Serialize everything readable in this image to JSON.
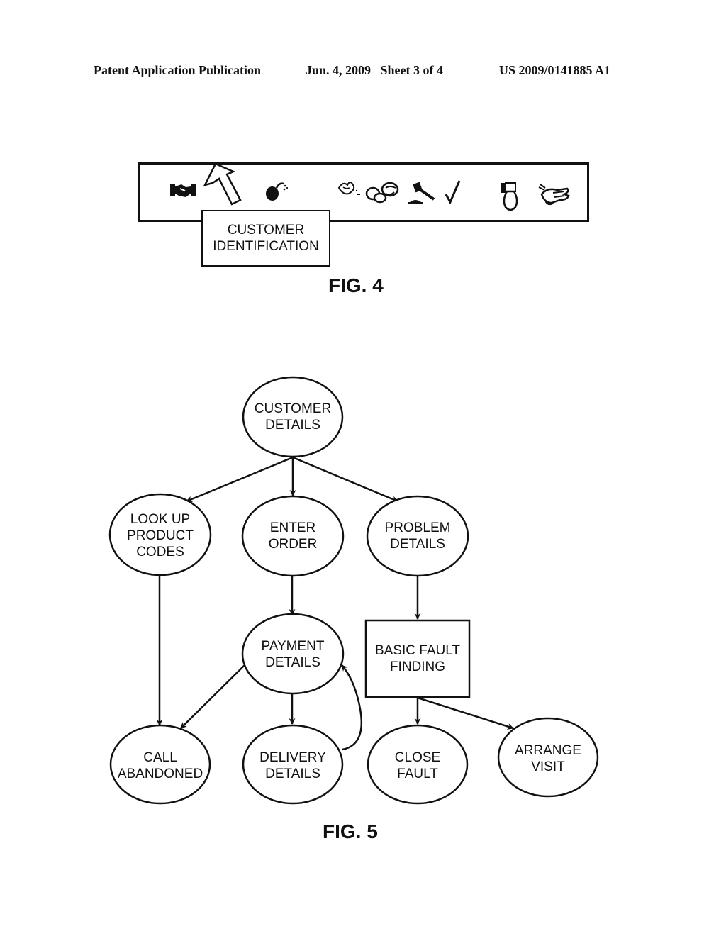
{
  "header": {
    "publication": "Patent Application Publication",
    "date_sheet": "Jun. 4, 2009   Sheet 3 of 4",
    "patent_number": "US 2009/0141885 A1"
  },
  "fig4": {
    "label": "FIG. 4",
    "toolbar_icons": [
      "handshake-icon",
      "cursor-arrow-icon",
      "bomb-icon",
      "bird-icon",
      "cloud-icon",
      "gavel-icon",
      "checkmark-icon",
      "lightbulb-icon",
      "helping-hand-icon"
    ],
    "tooltip": {
      "line1": "CUSTOMER",
      "line2": "IDENTIFICATION"
    }
  },
  "fig5": {
    "label": "FIG. 5",
    "nodes": {
      "customer_details": [
        "CUSTOMER",
        "DETAILS"
      ],
      "look_up_product_codes": [
        "LOOK UP",
        "PRODUCT",
        "CODES"
      ],
      "enter_order": [
        "ENTER",
        "ORDER"
      ],
      "problem_details": [
        "PROBLEM",
        "DETAILS"
      ],
      "payment_details": [
        "PAYMENT",
        "DETAILS"
      ],
      "basic_fault_finding": [
        "BASIC FAULT",
        "FINDING"
      ],
      "call_abandoned": [
        "CALL",
        "ABANDONED"
      ],
      "delivery_details": [
        "DELIVERY",
        "DETAILS"
      ],
      "close_fault": [
        "CLOSE",
        "FAULT"
      ],
      "arrange_visit": [
        "ARRANGE",
        "VISIT"
      ]
    },
    "edges": [
      [
        "customer_details",
        "look_up_product_codes"
      ],
      [
        "customer_details",
        "enter_order"
      ],
      [
        "customer_details",
        "problem_details"
      ],
      [
        "look_up_product_codes",
        "call_abandoned"
      ],
      [
        "enter_order",
        "payment_details"
      ],
      [
        "problem_details",
        "basic_fault_finding"
      ],
      [
        "payment_details",
        "call_abandoned"
      ],
      [
        "payment_details",
        "delivery_details"
      ],
      [
        "delivery_details",
        "payment_details"
      ],
      [
        "basic_fault_finding",
        "close_fault"
      ],
      [
        "basic_fault_finding",
        "arrange_visit"
      ]
    ]
  }
}
